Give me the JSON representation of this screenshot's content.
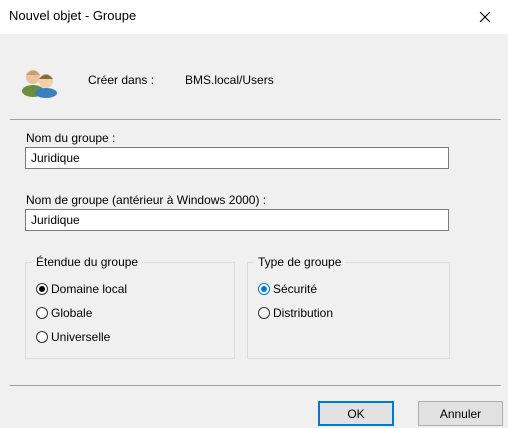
{
  "window": {
    "title": "Nouvel objet - Groupe",
    "close_icon": "close-icon"
  },
  "header": {
    "icon": "users-group-icon",
    "create_in_label": "Créer dans :",
    "create_in_value": "BMS.local/Users"
  },
  "form": {
    "group_name_label": "Nom du groupe :",
    "group_name_value": "Juridique",
    "group_name_pre2000_label": "Nom de groupe (antérieur à Windows 2000) :",
    "group_name_pre2000_value": "Juridique"
  },
  "scope": {
    "legend": "Étendue du groupe",
    "options": [
      "Domaine local",
      "Globale",
      "Universelle"
    ],
    "selected": "Domaine local"
  },
  "type": {
    "legend": "Type de groupe",
    "options": [
      "Sécurité",
      "Distribution"
    ],
    "selected": "Sécurité"
  },
  "buttons": {
    "ok": "OK",
    "cancel": "Annuler"
  },
  "colors": {
    "accent": "#0078d7",
    "background": "#f0f0f0"
  }
}
